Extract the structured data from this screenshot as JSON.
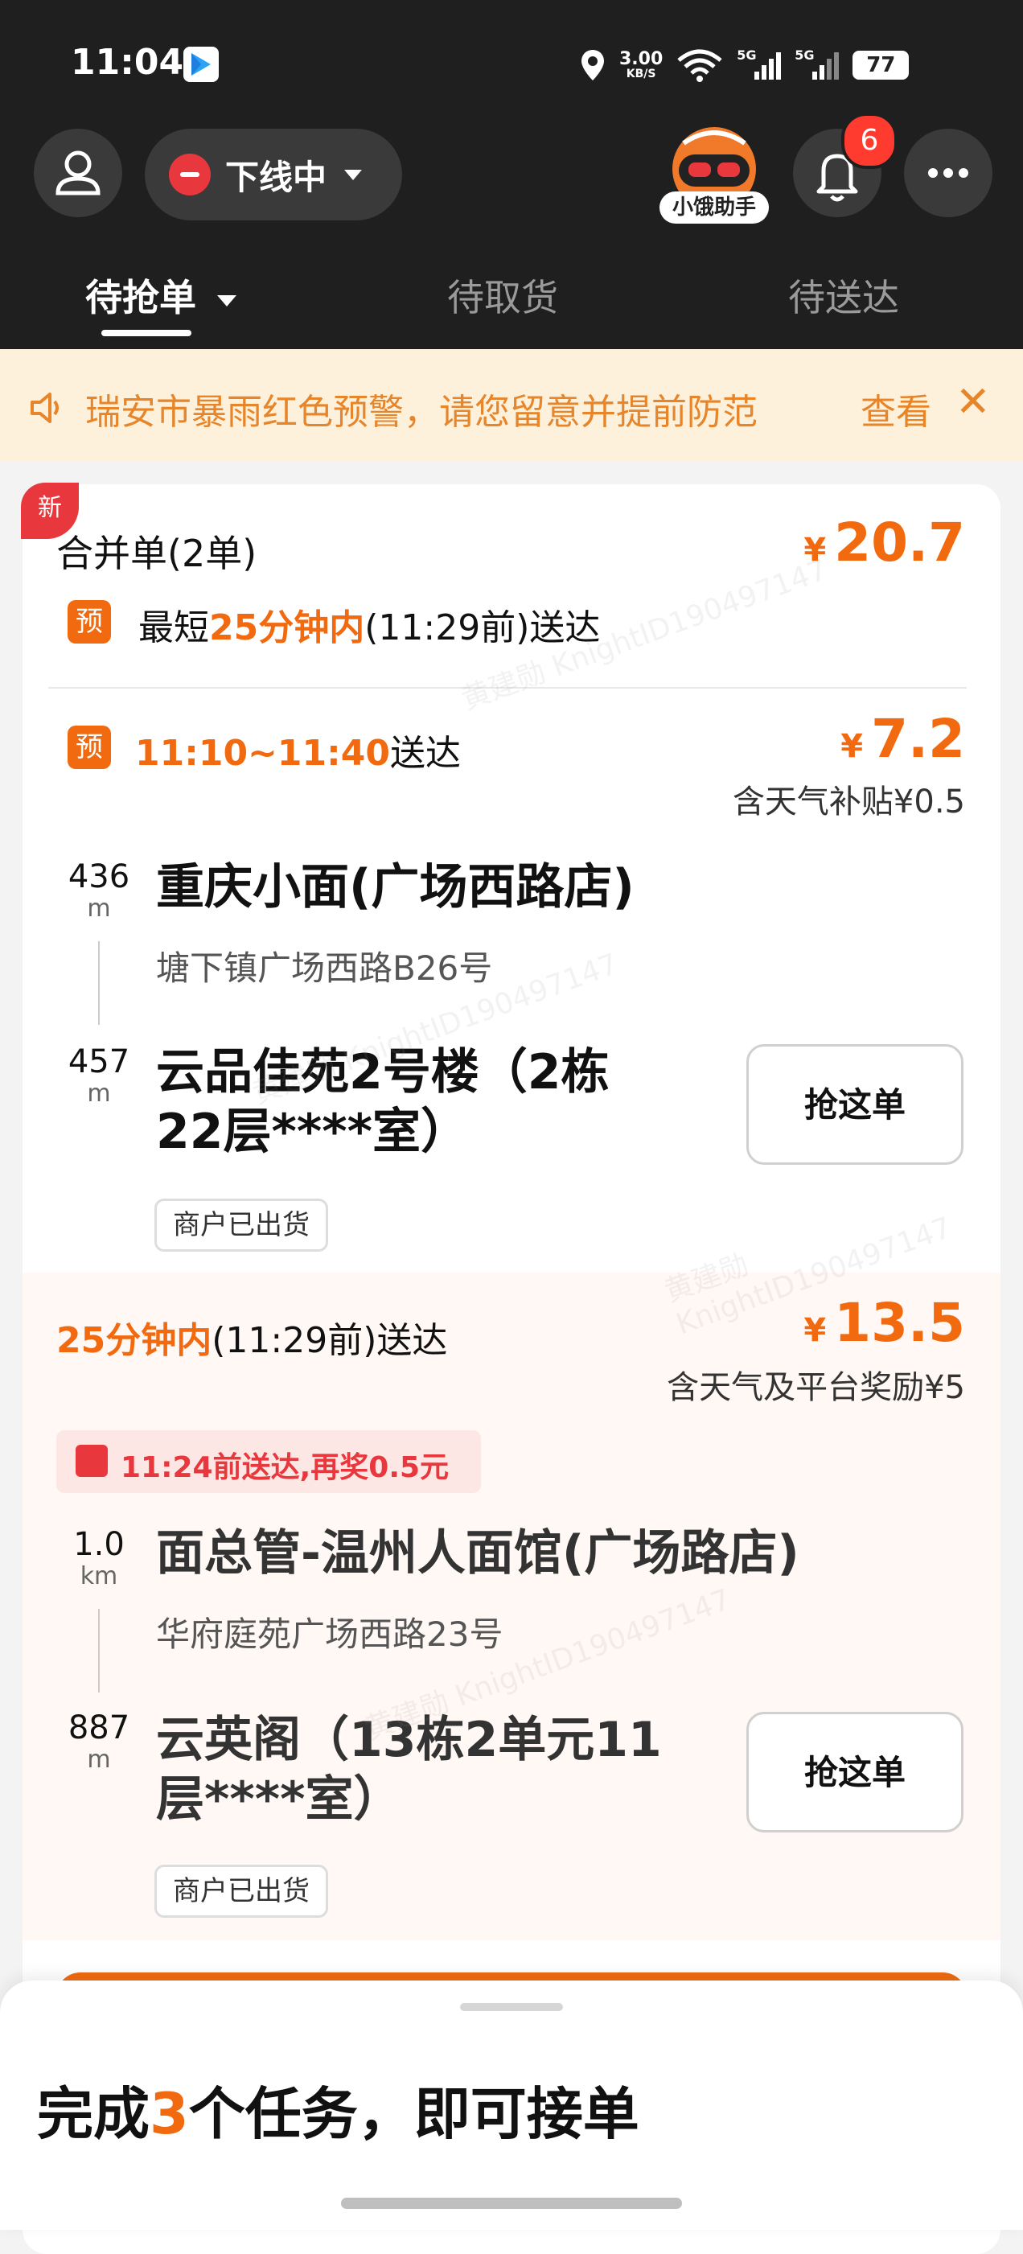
{
  "status_bar": {
    "time": "11:04",
    "net_speed_value": "3.00",
    "net_speed_unit": "KB/S",
    "signal_1": "5G",
    "signal_2": "5G",
    "battery": "77"
  },
  "header": {
    "status_label": "下线中",
    "assistant_label": "小饿助手",
    "notification_count": "6"
  },
  "tabs": [
    {
      "label": "待抢单"
    },
    {
      "label": "待取货"
    },
    {
      "label": "待送达"
    }
  ],
  "alert": {
    "text": "瑞安市暴雨红色预警，请您留意并提前防范",
    "action": "查看"
  },
  "merged_order": {
    "new_tag": "新",
    "title": "合并单(2单)",
    "currency": "¥",
    "total": "20.7",
    "pre_tag": "预",
    "eta_prefix": "最短",
    "eta_highlight": "25分钟内",
    "eta_suffix": "(11:29前)送达"
  },
  "order1": {
    "pre_tag": "预",
    "time_highlight": "11:10~11:40",
    "time_suffix": "送达",
    "currency": "¥",
    "price": "7.2",
    "subsidy": "含天气补贴¥0.5",
    "pickup_distance": "436",
    "pickup_unit": "m",
    "pickup_name": "重庆小面(广场西路店)",
    "pickup_address": "塘下镇广场西路B26号",
    "drop_distance": "457",
    "drop_unit": "m",
    "drop_name_line1": "云品佳苑2号楼（2栋",
    "drop_name_line2": "22层****室）",
    "grab_label": "抢这单",
    "chip": "商户已出货"
  },
  "order2": {
    "time_highlight": "25分钟内",
    "time_suffix": "(11:29前)送达",
    "currency": "¥",
    "price": "13.5",
    "subsidy": "含天气及平台奖励¥5",
    "bonus": "11:24前送达,再奖0.5元",
    "pickup_distance": "1.0",
    "pickup_unit": "km",
    "pickup_name": "面总管-温州人面馆(广场路店)",
    "pickup_address": "华府庭苑广场西路23号",
    "drop_distance": "887",
    "drop_unit": "m",
    "drop_name_line1": "云英阁（13栋2单元11",
    "drop_name_line2": "层****室）",
    "grab_label": "抢这单",
    "chip": "商户已出货"
  },
  "bottom_sheet": {
    "prefix": "完成",
    "count": "3",
    "suffix": "个任务，即可接单"
  },
  "watermark": "黄建勋 KnightID190497147",
  "colors": {
    "accent": "#f26a10",
    "alert": "#e7852a",
    "danger": "#e8383d",
    "header_bg": "#1f1f1f"
  }
}
